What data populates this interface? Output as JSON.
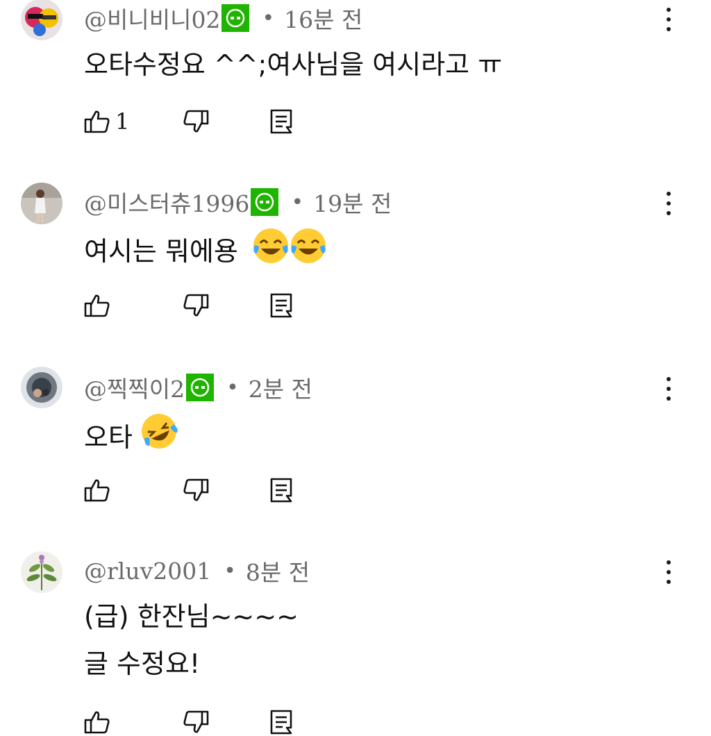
{
  "comments": [
    {
      "handle": "@비니비니02",
      "has_badge": true,
      "time": "16분 전",
      "lines": [
        "오타수정요 ^^;여사님을 여시라고 ㅠ"
      ],
      "like_count": "1",
      "avatar_color": "#cc3b5f"
    },
    {
      "handle": "@미스터츄1996",
      "has_badge": true,
      "time": "19분 전",
      "lines": [
        "여시는 뭐에용"
      ],
      "like_count": "",
      "avatar_color": "#8c8c8c"
    },
    {
      "handle": "@찍찍이2",
      "has_badge": true,
      "time": "2분 전",
      "lines": [
        "오타"
      ],
      "like_count": "",
      "avatar_color": "#5a6674"
    },
    {
      "handle": "@rluv2001",
      "has_badge": false,
      "time": "8분 전",
      "lines": [
        "(급) 한잔님~~~~",
        "글 수정요!"
      ],
      "like_count": "",
      "avatar_color": "#e8e6e0"
    }
  ],
  "separator": "•",
  "icons": {
    "like": "thumbs-up-icon",
    "dislike": "thumbs-down-icon",
    "reply": "reply-icon",
    "menu": "more-vert-icon",
    "badge": "member-badge-icon"
  },
  "colors": {
    "badge": "#1fb400",
    "meta_text": "#6a6a6a",
    "body_text": "#111111"
  }
}
